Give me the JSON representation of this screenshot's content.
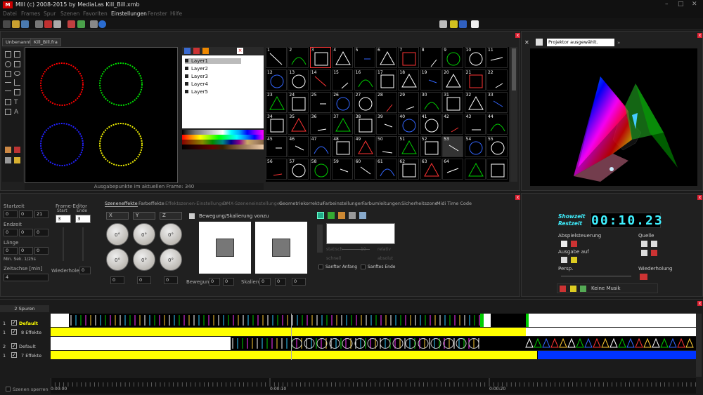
{
  "window": {
    "title": "MIII (c) 2008-2015 by MediaLas    Kill_Bill.xmb",
    "logo": "M"
  },
  "menu": [
    "Datei",
    "Frames",
    "Spur",
    "Szenen",
    "Favoriten",
    "Einstellungen",
    "Fenster",
    "Hilfe"
  ],
  "editor": {
    "tabs": [
      "Unbenannt",
      "Kill_Bill.fra"
    ],
    "status": "Ausgabepunkte im aktuellen Frame: 340",
    "layers": [
      "Layer1",
      "Layer2",
      "Layer3",
      "Layer4",
      "Layer5"
    ],
    "effect_numbers": [
      "1",
      "2",
      "3",
      "4",
      "5",
      "6",
      "7",
      "8",
      "9",
      "10",
      "11",
      "12",
      "13",
      "14",
      "15",
      "16",
      "17",
      "18",
      "19",
      "20",
      "21",
      "22",
      "23",
      "24",
      "25",
      "26",
      "27",
      "28",
      "29",
      "30",
      "31",
      "32",
      "33",
      "34",
      "35",
      "36",
      "37",
      "38",
      "39",
      "40",
      "41",
      "42",
      "43",
      "44",
      "45",
      "46",
      "47",
      "48",
      "49",
      "50",
      "51",
      "52",
      "53",
      "54",
      "55",
      "56",
      "57",
      "58",
      "59",
      "60",
      "61",
      "62",
      "63",
      "64"
    ]
  },
  "projector": {
    "status": "Projektor ausgewählt."
  },
  "scene": {
    "startzeit": "Startzeit",
    "endzeit": "Endzeit",
    "laenge": "Länge",
    "units": "Min.    Sek.    1/25s",
    "zeitachse": "Zeitachse [min]",
    "zeitachse_value": "4",
    "frame_editor": "Frame-Editor",
    "start": "Start",
    "ende": "Ende",
    "start_val": "3",
    "ende_val": "3",
    "wiederholen": "Wiederholen",
    "time_vals": [
      "0",
      "0",
      "21",
      "0",
      "0",
      "0",
      "0",
      "0",
      "0"
    ],
    "tabs": [
      "Szeneneffekte",
      "Farbeffekte",
      "Effektszenen-Einstellungen",
      "DMX-Szeneneinstellungen",
      "Geometriekorrektur",
      "Farbeinstellungen",
      "Farbumleitungen",
      "Sicherheitszone",
      "Midi Time Code"
    ],
    "axes": [
      "X",
      "Y",
      "Z"
    ],
    "knob_val": "0°",
    "bewegung_title": "Bewegung/Skalierung vonzu",
    "bewegung": "Bewegung",
    "skalierung": "Skalierung",
    "statisch": "statisch",
    "relativ": "relativ",
    "schnell": "schnell",
    "absolut": "absolut",
    "sanfter_anfang": "Sanfter Anfang",
    "sanftes_ende": "Sanftes Ende",
    "speed_val": "10"
  },
  "show": {
    "showzeit": "Showzeit",
    "restzeit": "Restzeit",
    "time": "00:10.23",
    "abspielsteuerung": "Abspielsteuerung",
    "quelle": "Quelle",
    "ausgabe_auf": "Ausgabe auf",
    "persp": "Persp.",
    "wiederholung": "Wiederholung",
    "keine_musik": "Keine Musik"
  },
  "timeline": {
    "spuren": "2 Spuren",
    "tracks": [
      {
        "num": "1",
        "name": "Default",
        "sub": "8 Effekte"
      },
      {
        "num": "2",
        "name": "Default",
        "sub": "7 Effekte"
      }
    ],
    "sub_num": "1",
    "ticks": [
      "0:00:00",
      "0:00:10",
      "0:00:20"
    ],
    "szenen_sperren": "Szenen sperren"
  },
  "colors": {
    "accent_yellow": "#ffff00",
    "accent_blue": "#0033ff",
    "digit_cyan": "#3ff0ff",
    "green": "#00c000"
  }
}
